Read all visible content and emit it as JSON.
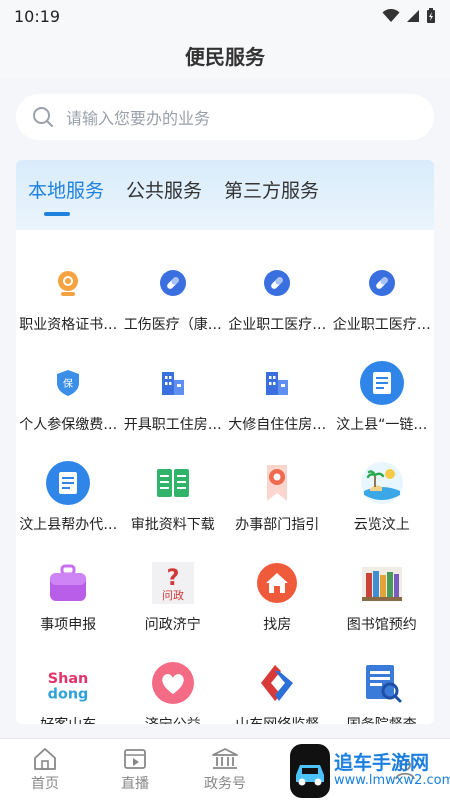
{
  "status": {
    "time": "10:19"
  },
  "header": {
    "title": "便民服务"
  },
  "search": {
    "placeholder": "请输入您要办的业务"
  },
  "tabs": [
    {
      "label": "本地服务",
      "active": true
    },
    {
      "label": "公共服务",
      "active": false
    },
    {
      "label": "第三方服务",
      "active": false
    }
  ],
  "services": [
    {
      "label": "职业资格证书…",
      "icon": "camera-badge-icon"
    },
    {
      "label": "工伤医疗（康…",
      "icon": "medical-capsule-icon"
    },
    {
      "label": "企业职工医疗…",
      "icon": "medical-capsule-icon"
    },
    {
      "label": "企业职工医疗…",
      "icon": "medical-capsule-icon"
    },
    {
      "label": "个人参保缴费…",
      "icon": "insurance-shield-icon"
    },
    {
      "label": "开具职工住房…",
      "icon": "building-icon"
    },
    {
      "label": "大修自住住房…",
      "icon": "building-icon"
    },
    {
      "label": "汶上县“一链…",
      "icon": "document-circle-icon"
    },
    {
      "label": "汶上县帮办代…",
      "icon": "document-circle-icon"
    },
    {
      "label": "审批资料下载",
      "icon": "open-book-icon"
    },
    {
      "label": "办事部门指引",
      "icon": "ribbon-bookmark-icon"
    },
    {
      "label": "云览汶上",
      "icon": "island-scenery-icon"
    },
    {
      "label": "事项申报",
      "icon": "briefcase-icon"
    },
    {
      "label": "问政济宁",
      "icon": "question-ask-icon"
    },
    {
      "label": "找房",
      "icon": "house-icon"
    },
    {
      "label": "图书馆预约",
      "icon": "bookshelf-icon"
    },
    {
      "label": "好客山东",
      "icon": "shandong-logo-icon"
    },
    {
      "label": "济宁公益",
      "icon": "heart-icon"
    },
    {
      "label": "山东网络监督",
      "icon": "network-supervision-icon"
    },
    {
      "label": "国务院督查",
      "icon": "inspection-doc-icon"
    }
  ],
  "bottom_nav": [
    {
      "label": "首页",
      "icon": "home-icon"
    },
    {
      "label": "直播",
      "icon": "video-icon"
    },
    {
      "label": "政务号",
      "icon": "government-building-icon"
    },
    {
      "label": "",
      "icon": "grid-apps-icon"
    },
    {
      "label": "",
      "icon": "user-icon"
    }
  ],
  "watermark": {
    "title": "追车手游网",
    "subtitle": "www.lmwxw2.com"
  },
  "colors": {
    "accent": "#1f82de",
    "tab_bg": "#dcedfb",
    "page_bg": "#f4f6f9"
  }
}
